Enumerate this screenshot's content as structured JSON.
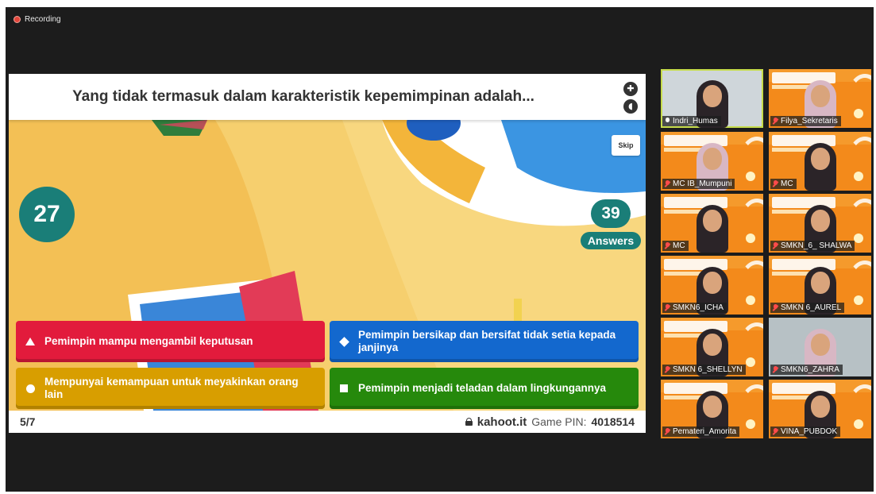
{
  "recording": {
    "label": "Recording"
  },
  "kahoot": {
    "question": "Yang tidak termasuk dalam karakteristik kepemimpinan adalah...",
    "timer": "27",
    "answer_count": "39",
    "answers_label": "Answers",
    "skip_label": "Skip",
    "options": [
      {
        "text": "Pemimpin mampu mengambil keputusan",
        "shape": "triangle",
        "color": "#e21b3c"
      },
      {
        "text": "Pemimpin bersikap dan bersifat tidak setia kepada janjinya",
        "shape": "diamond",
        "color": "#1368ce"
      },
      {
        "text": "Mempunyai kemampuan untuk meyakinkan orang lain",
        "shape": "circle",
        "color": "#d89e00"
      },
      {
        "text": "Pemimpin menjadi teladan dalam lingkungannya",
        "shape": "square",
        "color": "#26890c"
      }
    ],
    "progress": "5/7",
    "site": "kahoot.it",
    "pin_label": "Game PIN:",
    "pin": "4018514"
  },
  "participants": [
    {
      "name": "Indri_Humas",
      "muted": false,
      "active": true
    },
    {
      "name": "Filya_Sekretaris",
      "muted": true
    },
    {
      "name": "MC IB_Mumpuni",
      "muted": true
    },
    {
      "name": "MC",
      "muted": true
    },
    {
      "name": "MC",
      "muted": true
    },
    {
      "name": "SMKN_6_ SHALWA",
      "muted": true
    },
    {
      "name": "SMKN6_ICHA",
      "muted": true
    },
    {
      "name": "SMKN 6_AUREL",
      "muted": true
    },
    {
      "name": "SMKN 6_SHELLYN",
      "muted": true
    },
    {
      "name": "SMKN6_ZAHRA",
      "muted": true
    },
    {
      "name": "Pemateri_Amorita",
      "muted": true
    },
    {
      "name": "VINA_PUBDOK",
      "muted": true
    }
  ]
}
